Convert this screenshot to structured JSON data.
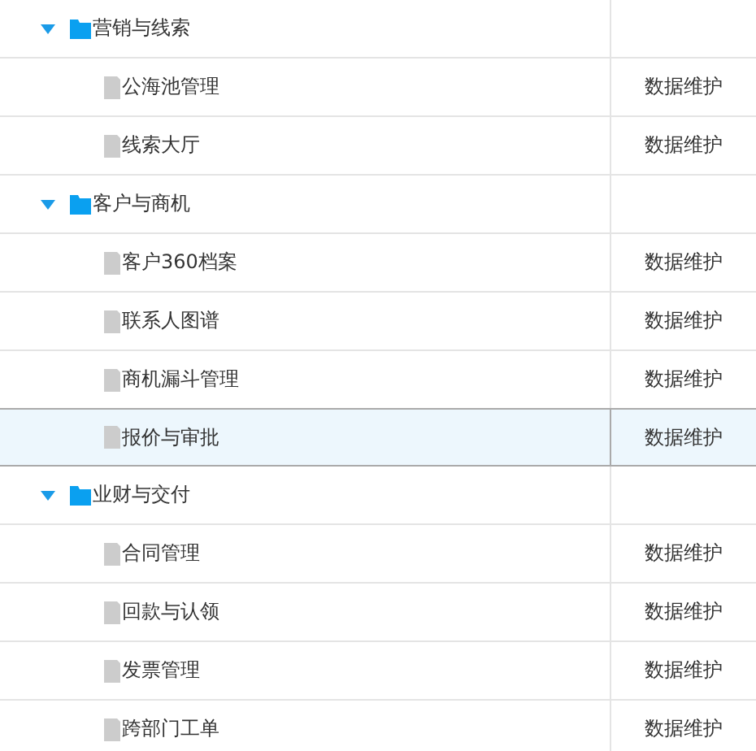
{
  "tree": [
    {
      "label": "营销与线索",
      "expanded": true,
      "selected": false,
      "children": [
        {
          "label": "公海池管理",
          "action": "数据维护",
          "selected": false
        },
        {
          "label": "线索大厅",
          "action": "数据维护",
          "selected": false
        }
      ]
    },
    {
      "label": "客户与商机",
      "expanded": true,
      "selected": false,
      "children": [
        {
          "label": "客户360档案",
          "action": "数据维护",
          "selected": false
        },
        {
          "label": "联系人图谱",
          "action": "数据维护",
          "selected": false
        },
        {
          "label": "商机漏斗管理",
          "action": "数据维护",
          "selected": false
        },
        {
          "label": "报价与审批",
          "action": "数据维护",
          "selected": true
        }
      ]
    },
    {
      "label": "业财与交付",
      "expanded": true,
      "selected": false,
      "children": [
        {
          "label": "合同管理",
          "action": "数据维护",
          "selected": false
        },
        {
          "label": "回款与认领",
          "action": "数据维护",
          "selected": false
        },
        {
          "label": "发票管理",
          "action": "数据维护",
          "selected": false
        },
        {
          "label": "跨部门工单",
          "action": "数据维护",
          "selected": false
        }
      ]
    }
  ]
}
